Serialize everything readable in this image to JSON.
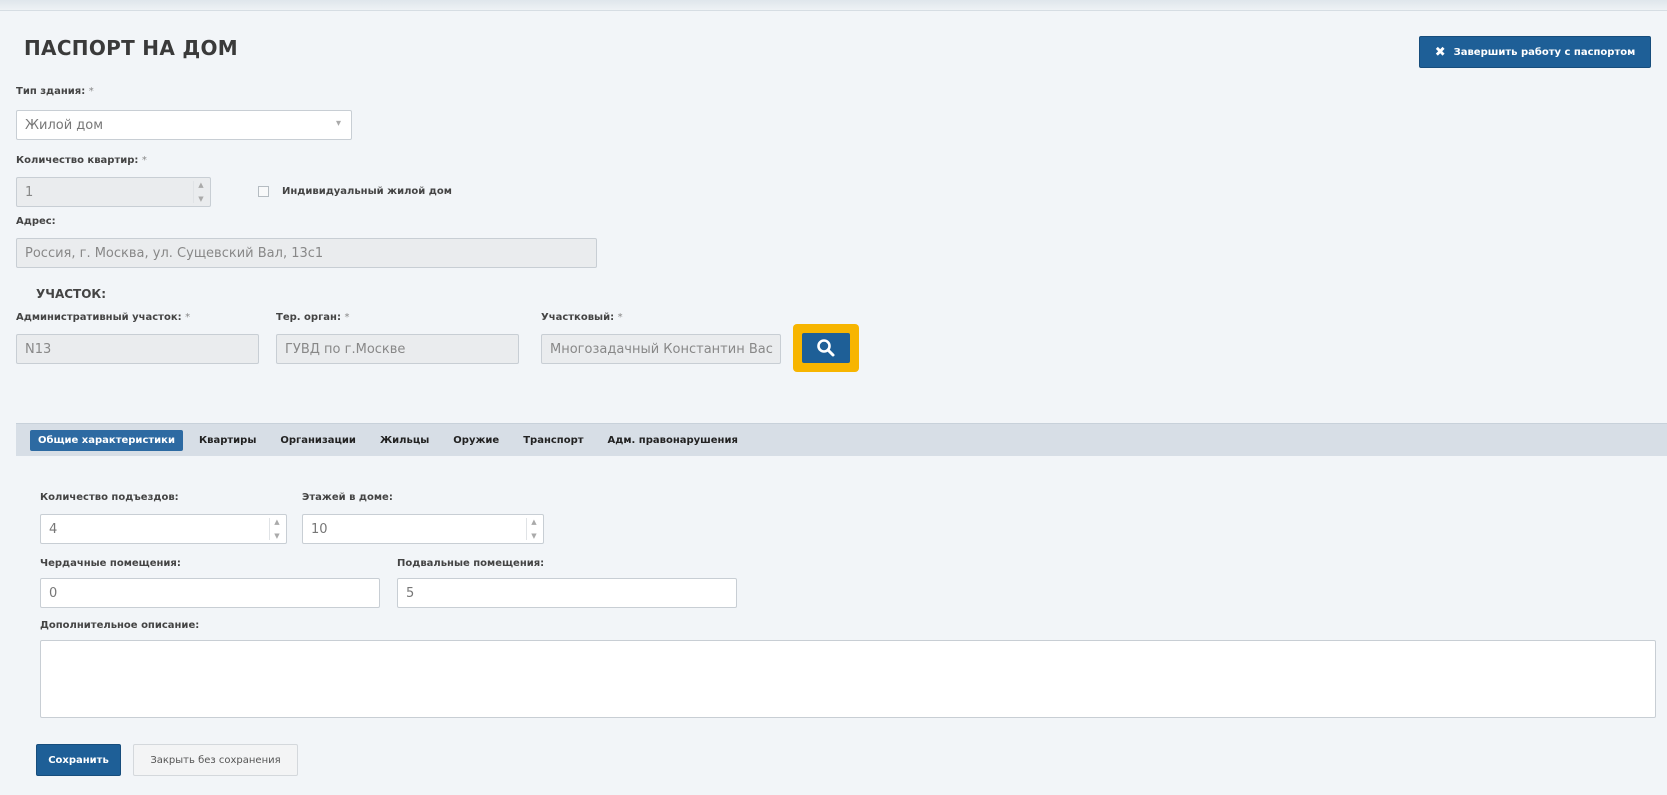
{
  "page": {
    "title": "ПАСПОРТ НА ДОМ"
  },
  "header": {
    "finish_button": "Завершить работу с паспортом",
    "finish_icon": "close-x-icon"
  },
  "building": {
    "type_label": "Тип здания:",
    "type_value": "Жилой дом",
    "flats_label": "Количество квартир:",
    "flats_value": "1",
    "individual_label": "Индивидуальный жилой дом",
    "address_label": "Адрес:",
    "address_value": "Россия, г. Москва, ул. Сущевский Вал, 13с1"
  },
  "plot": {
    "section_label": "УЧАСТОК:",
    "admin_label": "Административный участок:",
    "admin_value": "N13",
    "ter_label": "Тер. орган:",
    "ter_value": "ГУВД по г.Москве",
    "officer_label": "Участковый:",
    "officer_value": "Многозадачный Константин Вас",
    "search_icon": "search-icon"
  },
  "tabs": [
    "Общие характеристики",
    "Квартиры",
    "Организации",
    "Жильцы",
    "Оружие",
    "Транспорт",
    "Адм. правонарушения"
  ],
  "general": {
    "entrances_label": "Количество подъездов:",
    "entrances_value": "4",
    "floors_label": "Этажей в доме:",
    "floors_value": "10",
    "attic_label": "Чердачные помещения:",
    "attic_value": "0",
    "basement_label": "Подвальные помещения:",
    "basement_value": "5",
    "description_label": "Дополнительное описание:",
    "description_value": ""
  },
  "actions": {
    "save": "Сохранить",
    "close": "Закрыть без сохранения"
  },
  "colors": {
    "primary": "#1e5f97",
    "highlight": "#f7b500",
    "tabbar": "#d7dee6"
  },
  "required_mark": "*"
}
